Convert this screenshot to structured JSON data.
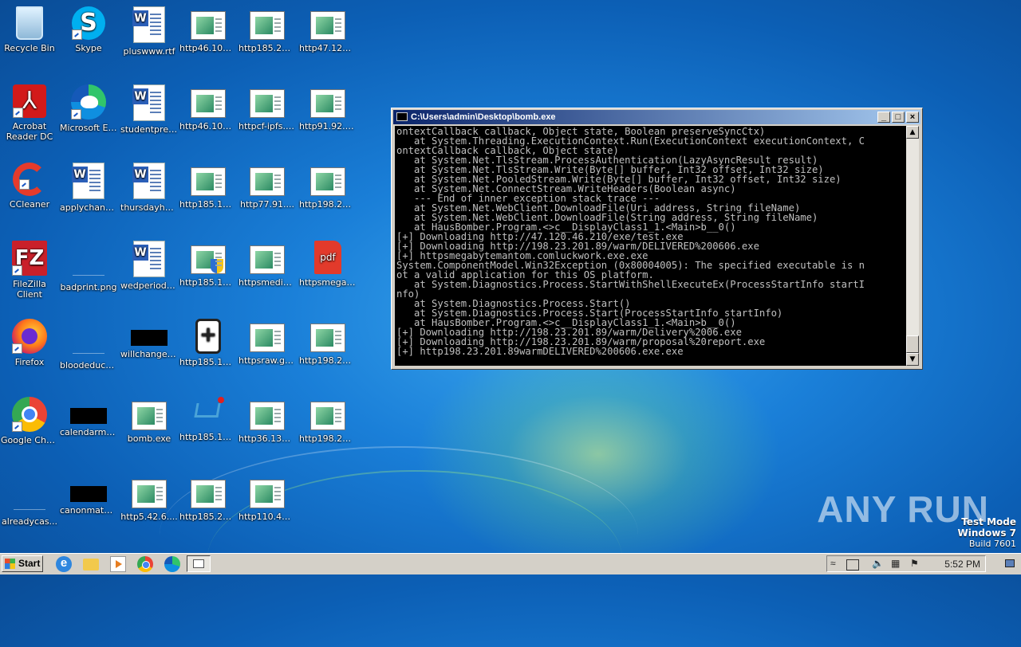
{
  "desktop": {
    "icons": [
      {
        "label": "Recycle Bin",
        "kind": "recycle-bin"
      },
      {
        "label": "Skype",
        "kind": "skype"
      },
      {
        "label": "pluswww.rtf",
        "kind": "word-doc"
      },
      {
        "label": "http46.102....",
        "kind": "exe"
      },
      {
        "label": "http185.21....",
        "kind": "exe"
      },
      {
        "label": "http47.120....",
        "kind": "exe"
      },
      {
        "label": "Acrobat Reader DC",
        "kind": "acrobat"
      },
      {
        "label": "Microsoft Edge",
        "kind": "edge"
      },
      {
        "label": "studentpres...",
        "kind": "word-doc"
      },
      {
        "label": "http46.102....",
        "kind": "exe"
      },
      {
        "label": "httpcf-ipfs.c...",
        "kind": "exe"
      },
      {
        "label": "http91.92.2...",
        "kind": "exe"
      },
      {
        "label": "CCleaner",
        "kind": "ccleaner"
      },
      {
        "label": "applychanc...",
        "kind": "word-doc"
      },
      {
        "label": "thursdayhu...",
        "kind": "word-doc"
      },
      {
        "label": "http185.17....",
        "kind": "exe"
      },
      {
        "label": "http77.91....",
        "kind": "exe"
      },
      {
        "label": "http198.23....",
        "kind": "exe"
      },
      {
        "label": "FileZilla Client",
        "kind": "filezilla"
      },
      {
        "label": "badprint.png",
        "kind": "blank"
      },
      {
        "label": "wedperiod.rtf",
        "kind": "word-doc"
      },
      {
        "label": "http185.17....",
        "kind": "exe-shield"
      },
      {
        "label": "httpsmediafi...",
        "kind": "exe"
      },
      {
        "label": "httpsmegab...",
        "kind": "pdf"
      },
      {
        "label": "Firefox",
        "kind": "firefox"
      },
      {
        "label": "bloodeduca...",
        "kind": "blank"
      },
      {
        "label": "willchanges....",
        "kind": "black"
      },
      {
        "label": "http185.17....",
        "kind": "medicine"
      },
      {
        "label": "httpsraw.git...",
        "kind": "exe"
      },
      {
        "label": "http198.23....",
        "kind": "exe"
      },
      {
        "label": "Google Chrome",
        "kind": "chrome"
      },
      {
        "label": "calendarmet...",
        "kind": "black"
      },
      {
        "label": "bomb.exe",
        "kind": "exe"
      },
      {
        "label": "http185.17....",
        "kind": "cart"
      },
      {
        "label": "http36.133....",
        "kind": "exe"
      },
      {
        "label": "http198.23....",
        "kind": "exe"
      },
      {
        "label": "alreadycas...",
        "kind": "blank"
      },
      {
        "label": "canonmater...",
        "kind": "black"
      },
      {
        "label": "http5.42.6....",
        "kind": "exe"
      },
      {
        "label": "http185.21....",
        "kind": "exe"
      },
      {
        "label": "http110.41....",
        "kind": "exe"
      }
    ]
  },
  "console": {
    "title": "C:\\Users\\admin\\Desktop\\bomb.exe",
    "minimize": "_",
    "maximize": "□",
    "close": "×",
    "output": "ontextCallback callback, Object state, Boolean preserveSyncCtx)\n   at System.Threading.ExecutionContext.Run(ExecutionContext executionContext, C\nontextCallback callback, Object state)\n   at System.Net.TlsStream.ProcessAuthentication(LazyAsyncResult result)\n   at System.Net.TlsStream.Write(Byte[] buffer, Int32 offset, Int32 size)\n   at System.Net.PooledStream.Write(Byte[] buffer, Int32 offset, Int32 size)\n   at System.Net.ConnectStream.WriteHeaders(Boolean async)\n   --- End of inner exception stack trace ---\n   at System.Net.WebClient.DownloadFile(Uri address, String fileName)\n   at System.Net.WebClient.DownloadFile(String address, String fileName)\n   at HausBomber.Program.<>c__DisplayClass1_1.<Main>b__0()\n[+] Downloading http://47.120.46.210/exe/test.exe\n[+] Downloading http://198.23.201.89/warm/DELIVERED%200606.exe\n[+] httpsmegabytemantom.comluckwork.exe.exe\nSystem.ComponentModel.Win32Exception (0x80004005): The specified executable is n\not a valid application for this OS platform.\n   at System.Diagnostics.Process.StartWithShellExecuteEx(ProcessStartInfo startI\nnfo)\n   at System.Diagnostics.Process.Start()\n   at System.Diagnostics.Process.Start(ProcessStartInfo startInfo)\n   at HausBomber.Program.<>c__DisplayClass1_1.<Main>b__0()\n[+] Downloading http://198.23.201.89/warm/Delivery%2006.exe\n[+] Downloading http://198.23.201.89/warm/proposal%20report.exe\n[+] http198.23.201.89warmDELIVERED%200606.exe.exe"
  },
  "watermark": {
    "text": "ANY RUN"
  },
  "os_info": {
    "mode": "Test Mode",
    "version": "Windows 7",
    "build": "Build 7601"
  },
  "taskbar": {
    "start_label": "Start",
    "tray_chevron": "≈",
    "clock": "5:52 PM",
    "icons": [
      "ie-icon",
      "explorer-icon",
      "media-player-icon",
      "chrome-icon",
      "edge-icon",
      "console-task-icon"
    ]
  }
}
